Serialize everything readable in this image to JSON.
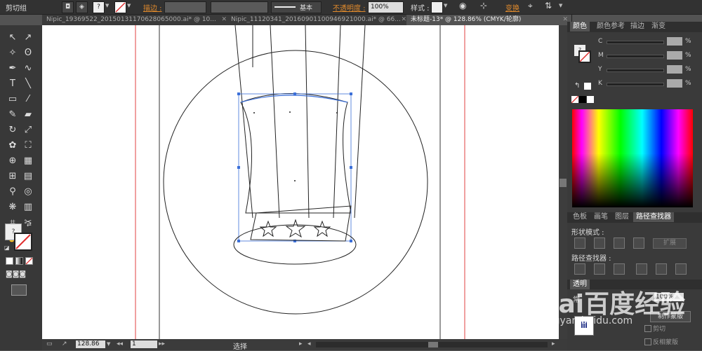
{
  "topbar": {
    "group_label": "剪切组",
    "stroke_label": "描边 :",
    "stroke_style": "基本",
    "opacity_label": "不透明度 :",
    "opacity_value": "100%",
    "style_label": "样式 :",
    "transform_label": "变换"
  },
  "tabs": [
    {
      "label": "Nipic_19369522_20150131170628065000.ai* @ 10..."
    },
    {
      "label": "Nipic_11120341_20160901100946921000.ai* @ 66..."
    },
    {
      "label": "未标题-13* @ 128.86% (CMYK/轮廓)"
    }
  ],
  "swatch_question": "?",
  "color_panel": {
    "tabs": [
      "颜色",
      "颜色参考",
      "描边",
      "渐变"
    ],
    "sliders": [
      "C",
      "M",
      "Y",
      "K"
    ],
    "percent": "%"
  },
  "pathfinder_panel": {
    "tabs": [
      "色板",
      "画笔",
      "图层",
      "路径查找器"
    ],
    "shape_modes_label": "形状模式 :",
    "expand_button": "扩展",
    "pathfinders_label": "路径查找器 :"
  },
  "transparency_panel": {
    "title": "透明",
    "mode": "常",
    "opacity": "100%",
    "make_mask_button": "制作蒙版",
    "clip_label": "剪切",
    "invert_mask_label": "反相蒙版"
  },
  "status": {
    "zoom": "128.86",
    "page": "1",
    "tool": "选择"
  },
  "watermark": {
    "logo": "Bai百度经验",
    "url": "jingyan.baidu.com"
  },
  "colors": {
    "guide": "#e04040",
    "path": "#222222",
    "selection": "#3b6fd8",
    "accent_orange": "#e08a2c"
  }
}
